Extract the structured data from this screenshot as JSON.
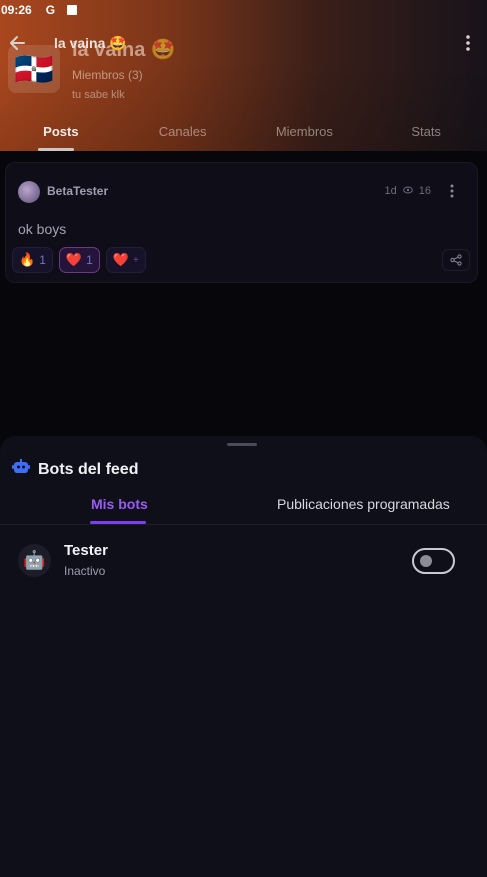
{
  "status_bar": {
    "time": "09:26",
    "g": "G"
  },
  "header": {
    "small_title": "la vaina 🤩",
    "big_title": "la vaina 🤩",
    "members": "Miembros (3)",
    "description": "tu sabe klk",
    "flag": "🇩🇴",
    "tabs": [
      {
        "label": "Posts",
        "active": true
      },
      {
        "label": "Canales",
        "active": false
      },
      {
        "label": "Miembros",
        "active": false
      },
      {
        "label": "Stats",
        "active": false
      }
    ]
  },
  "post": {
    "author": "BetaTester",
    "age": "1d",
    "views": "16",
    "text": "ok boys",
    "reactions": [
      {
        "emoji": "🔥",
        "count": "1",
        "selected": false
      },
      {
        "emoji": "❤️",
        "count": "1",
        "selected": true
      },
      {
        "emoji": "❤️",
        "count": "+",
        "selected": false
      }
    ]
  },
  "sheet": {
    "title": "Bots del feed",
    "tabs": [
      {
        "label": "Mis bots",
        "active": true
      },
      {
        "label": "Publicaciones programadas",
        "active": false
      }
    ],
    "bots": [
      {
        "name": "Tester",
        "status": "Inactivo",
        "enabled": false,
        "icon": "robot-icon"
      }
    ]
  },
  "colors": {
    "accent": "#7b3ff0",
    "header_start": "#a9471e",
    "sheet_bg": "#0f0f1a"
  }
}
